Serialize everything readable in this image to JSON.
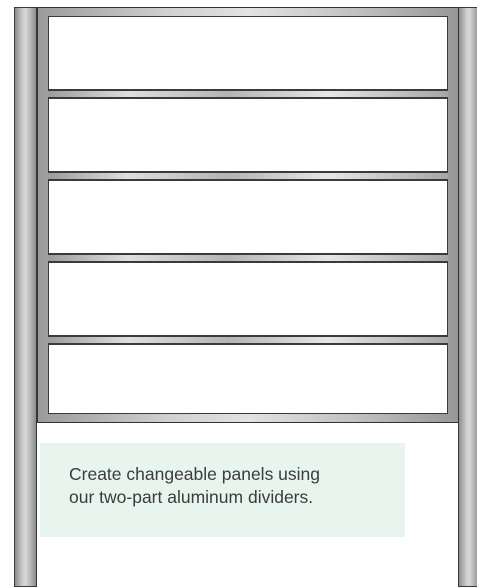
{
  "caption": {
    "text": "Create changeable panels using\nour two-part aluminum dividers."
  },
  "diagram": {
    "panel_count": 5,
    "divider_count": 4,
    "colors": {
      "post": "#b5b5b5",
      "frame_outline": "#333333",
      "panel": "#ffffff",
      "caption_background": "#e8f4ee",
      "caption_text": "#3c3c3c"
    }
  }
}
